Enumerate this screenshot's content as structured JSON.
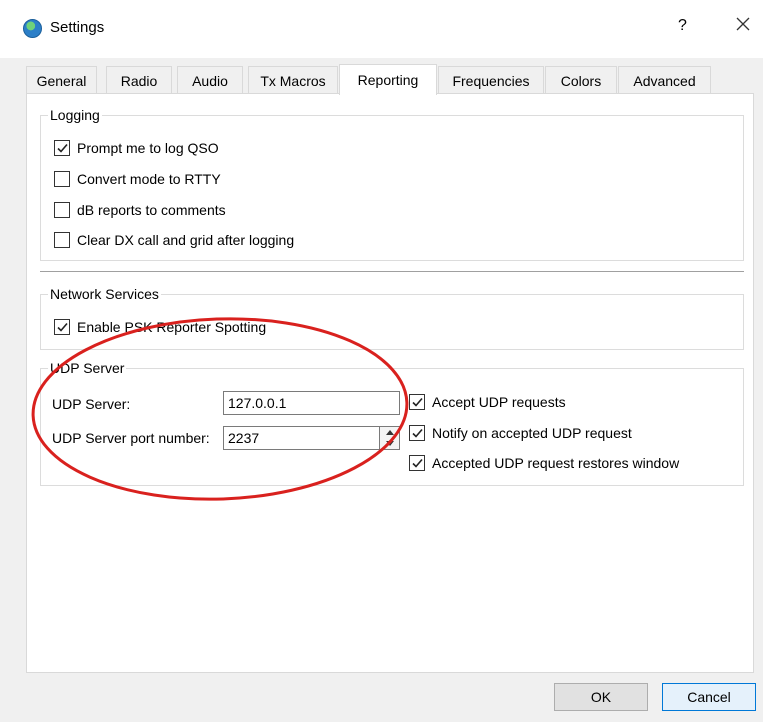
{
  "window": {
    "title": "Settings",
    "help": "?",
    "close_icon": "close-icon",
    "app_icon": "globe-icon"
  },
  "tabs": [
    {
      "label": "General"
    },
    {
      "label": "Radio"
    },
    {
      "label": "Audio"
    },
    {
      "label": "Tx Macros"
    },
    {
      "label": "Reporting"
    },
    {
      "label": "Frequencies"
    },
    {
      "label": "Colors"
    },
    {
      "label": "Advanced"
    }
  ],
  "active_tab": "Reporting",
  "logging": {
    "title": "Logging",
    "items": [
      {
        "label": "Prompt me to log QSO",
        "checked": true
      },
      {
        "label": "Convert mode to RTTY",
        "checked": false
      },
      {
        "label": "dB reports to comments",
        "checked": false
      },
      {
        "label": "Clear DX call and grid after logging",
        "checked": false
      }
    ]
  },
  "network": {
    "title": "Network Services",
    "psk": {
      "label": "Enable PSK Reporter Spotting",
      "checked": true
    }
  },
  "udp": {
    "title": "UDP Server",
    "server_label": "UDP Server:",
    "server_value": "127.0.0.1",
    "port_label": "UDP Server port number:",
    "port_value": "2237",
    "options": [
      {
        "label": "Accept UDP requests",
        "checked": true
      },
      {
        "label": "Notify on accepted UDP request",
        "checked": true
      },
      {
        "label": "Accepted UDP request restores window",
        "checked": true
      }
    ]
  },
  "buttons": {
    "ok": "OK",
    "cancel": "Cancel"
  },
  "colors": {
    "annotation": "#d9211e",
    "accent": "#0078d7"
  }
}
